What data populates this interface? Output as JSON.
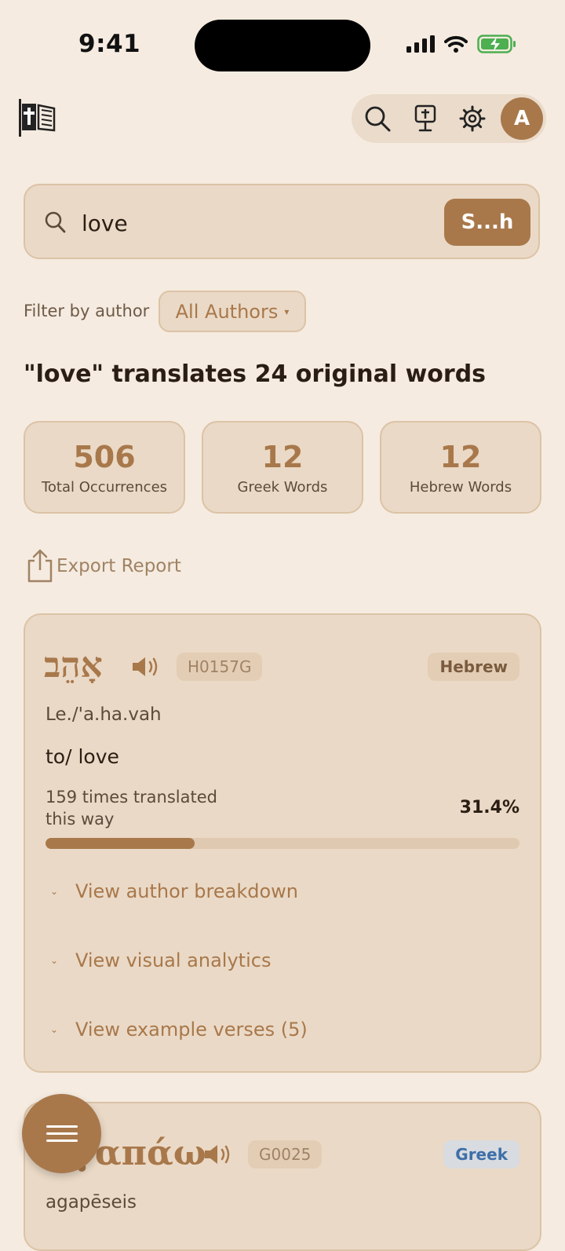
{
  "status_bar": {
    "time": "9:41"
  },
  "header": {
    "logo_icon": "bible-cross-icon",
    "avatar_initial": "A",
    "icons": [
      "search-icon",
      "lectern-icon",
      "gear-icon"
    ]
  },
  "search": {
    "value": "love",
    "button_label": "S...h"
  },
  "filter": {
    "label": "Filter by author",
    "selected": "All Authors",
    "caret": "▾"
  },
  "results": {
    "heading": "\"love\" translates 24 original words",
    "stats": [
      {
        "value": "506",
        "label": "Total Occurrences"
      },
      {
        "value": "12",
        "label": "Greek Words"
      },
      {
        "value": "12",
        "label": "Hebrew Words"
      }
    ],
    "export_label": "Export Report"
  },
  "cards": [
    {
      "word": "אָהֵב",
      "code": "H0157G",
      "language": "Hebrew",
      "transliteration": "Le./'a.ha.vah",
      "gloss": "to/ love",
      "times_text": "159 times translated this way",
      "percent_text": "31.4%",
      "percent": 31.4,
      "expanders": [
        "View author breakdown",
        "View visual analytics",
        "View example verses (5)"
      ]
    },
    {
      "word": "ἀγαπάω",
      "code": "G0025",
      "language": "Greek",
      "transliteration": "agapēseis"
    }
  ],
  "colors": {
    "accent": "#a8784b",
    "background": "#f5ebe0",
    "card": "#ead9c6",
    "greek_badge_text": "#3d6fa8"
  }
}
